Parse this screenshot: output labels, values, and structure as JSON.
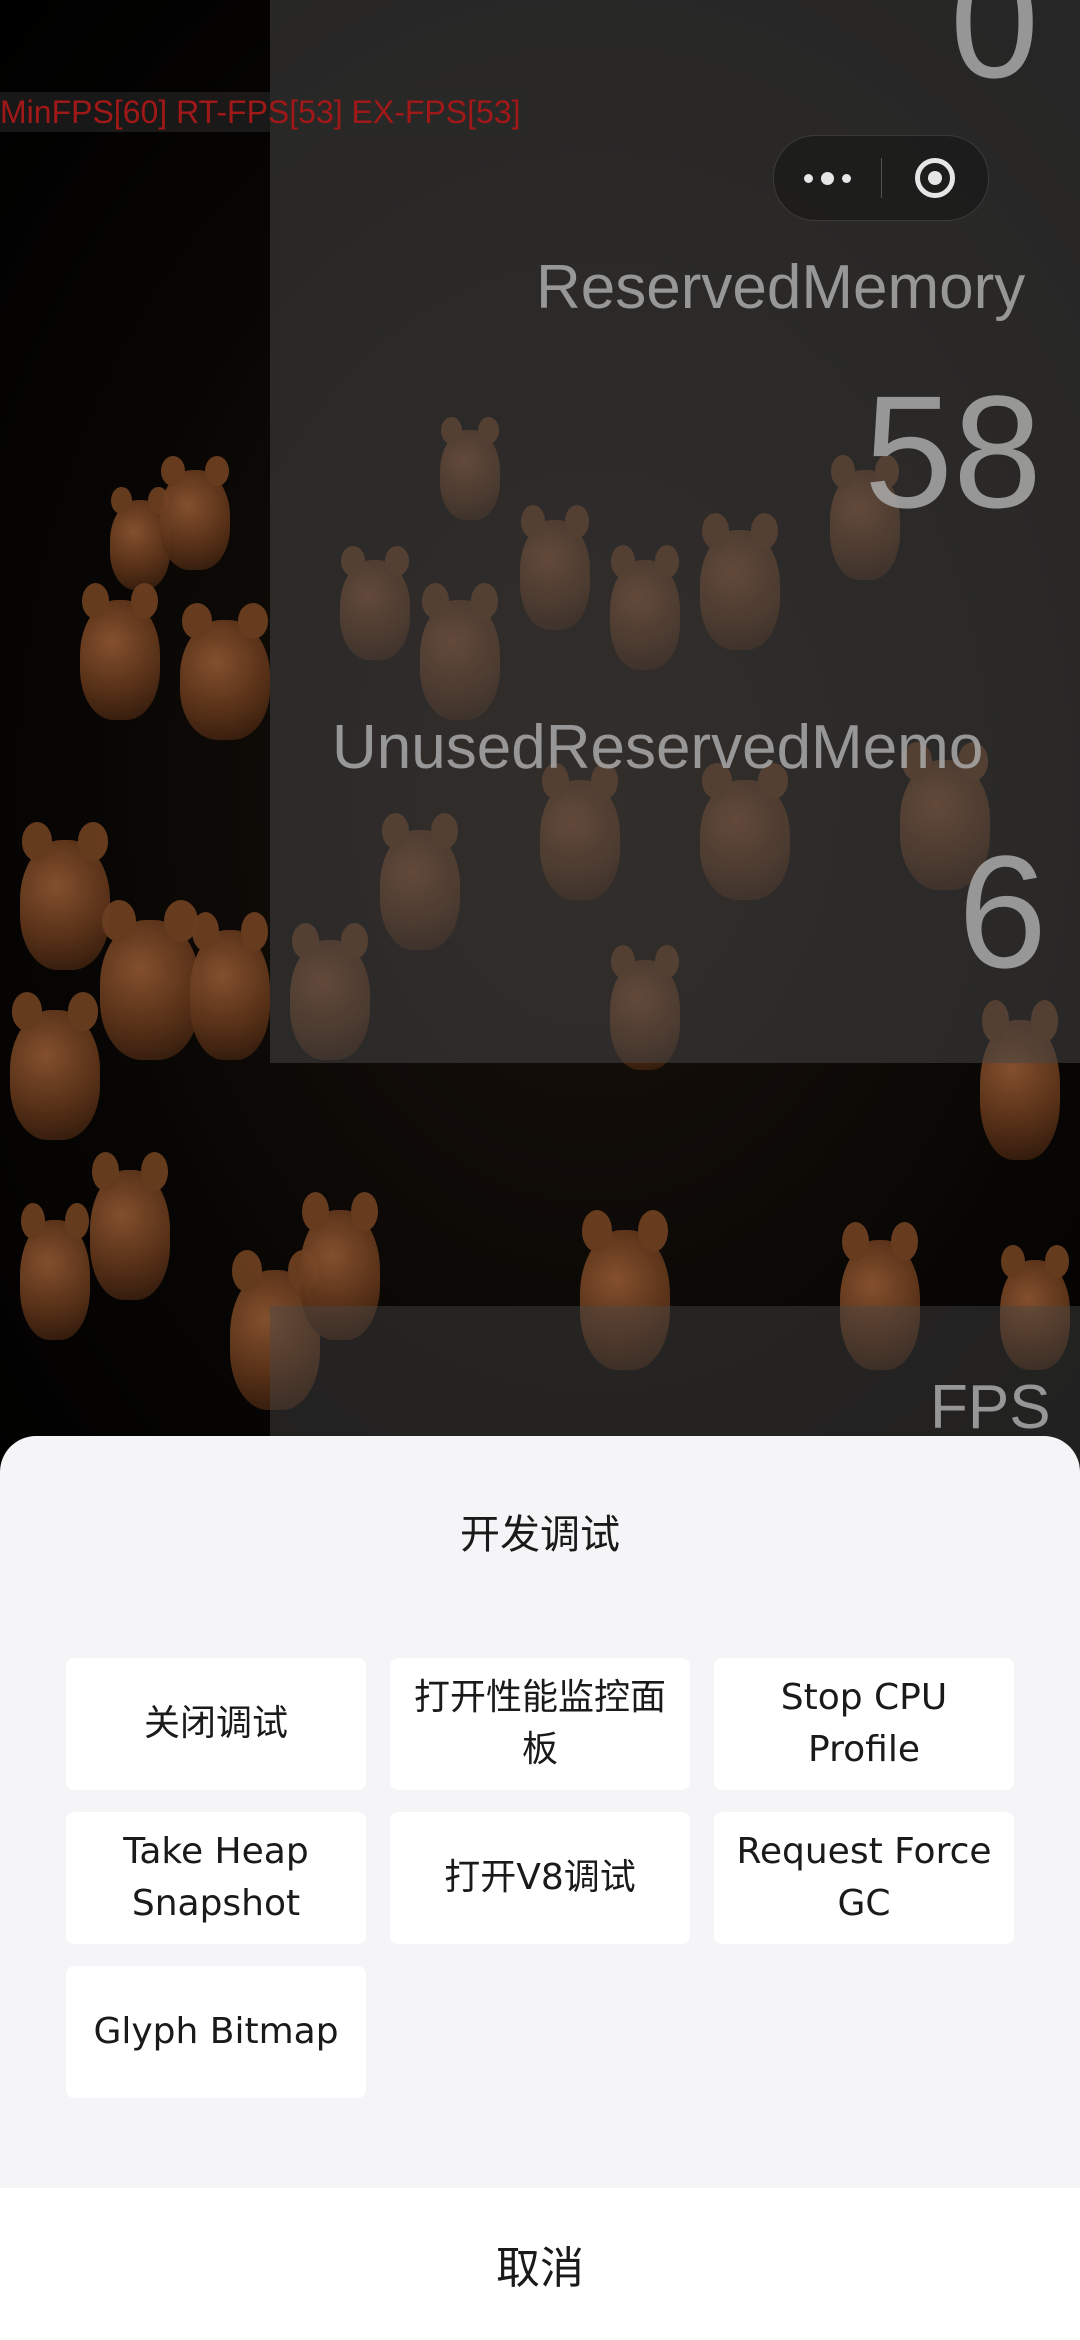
{
  "debug_overlay": {
    "fps_line": "MinFPS[60] RT-FPS[53] EX-FPS[53]",
    "top_value": "0",
    "reserved_memory_label": "ReservedMemory",
    "reserved_memory_value": "58",
    "unused_reserved_label": "UnusedReservedMemo",
    "unused_reserved_value": "6",
    "fps_label": "FPS"
  },
  "capsule": {
    "more_icon": "more-dots-icon",
    "close_icon": "target-icon"
  },
  "sheet": {
    "title": "开发调试",
    "actions": [
      {
        "label": "关闭调试"
      },
      {
        "label": "打开性能监控面板"
      },
      {
        "label": "Stop CPU Profile"
      },
      {
        "label": "Take Heap Snapshot"
      },
      {
        "label": "打开V8调试"
      },
      {
        "label": "Request Force GC"
      },
      {
        "label": "Glyph Bitmap"
      }
    ],
    "cancel_label": "取消"
  }
}
